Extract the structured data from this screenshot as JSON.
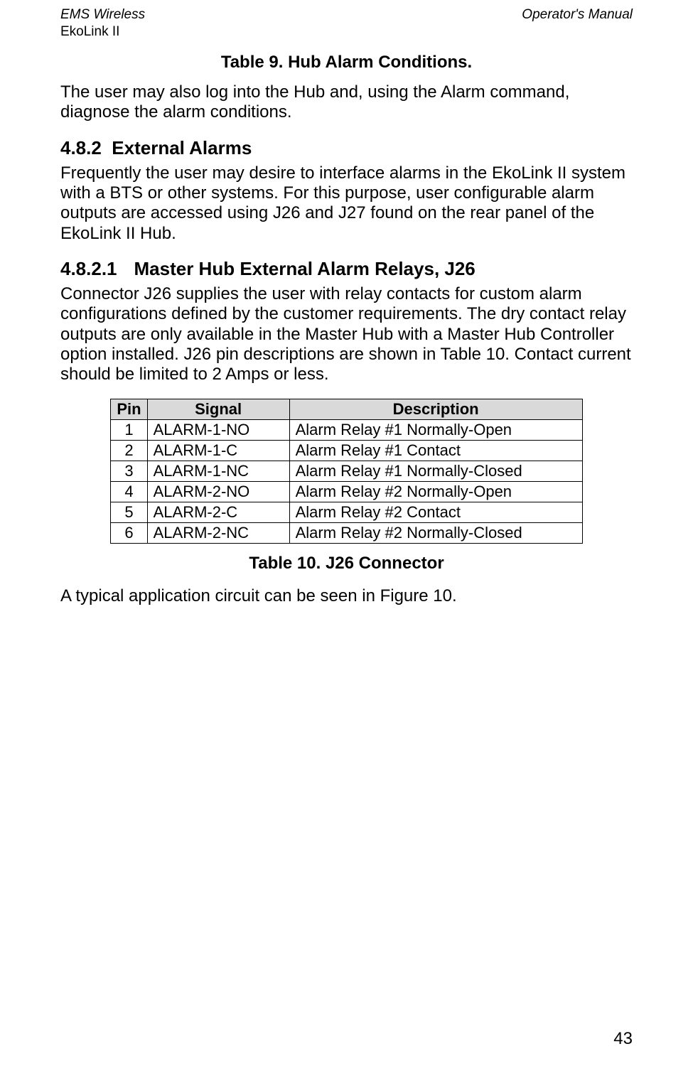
{
  "header": {
    "left_line1": "EMS Wireless",
    "left_line2": "EkoLink II",
    "right": "Operator's Manual"
  },
  "caption_table9": "Table 9.  Hub Alarm Conditions.",
  "intro_text": "The user may also log into the Hub and, using the Alarm command, diagnose the alarm conditions.",
  "section_482": {
    "number": "4.8.2",
    "title": "External Alarms",
    "text": "Frequently the user may desire to interface alarms in the EkoLink II system with a BTS or other systems.  For this purpose, user configurable alarm outputs are accessed using J26 and J27 found on the rear panel of the EkoLink II Hub."
  },
  "section_4821": {
    "number": "4.8.2.1",
    "title": "Master Hub External Alarm Relays, J26",
    "text": "Connector J26 supplies the user with relay contacts for custom alarm configurations defined by the customer requirements.  The dry contact relay outputs are only available in the Master Hub with a Master Hub Controller option installed.   J26 pin descriptions are shown in Table 10.  Contact current should be limited to 2 Amps or less."
  },
  "table10": {
    "headers": {
      "pin": "Pin",
      "signal": "Signal",
      "description": "Description"
    },
    "rows": [
      {
        "pin": "1",
        "signal": "ALARM-1-NO",
        "description": "Alarm Relay #1 Normally-Open"
      },
      {
        "pin": "2",
        "signal": "ALARM-1-C",
        "description": "Alarm Relay #1 Contact"
      },
      {
        "pin": "3",
        "signal": "ALARM-1-NC",
        "description": "Alarm Relay #1 Normally-Closed"
      },
      {
        "pin": "4",
        "signal": "ALARM-2-NO",
        "description": "Alarm Relay #2 Normally-Open"
      },
      {
        "pin": "5",
        "signal": "ALARM-2-C",
        "description": "Alarm Relay #2 Contact"
      },
      {
        "pin": "6",
        "signal": "ALARM-2-NC",
        "description": "Alarm Relay #2 Normally-Closed"
      }
    ],
    "caption": "Table 10.  J26 Connector"
  },
  "after_table_text": "A typical application circuit can be seen in Figure 10.",
  "page_number": "43"
}
